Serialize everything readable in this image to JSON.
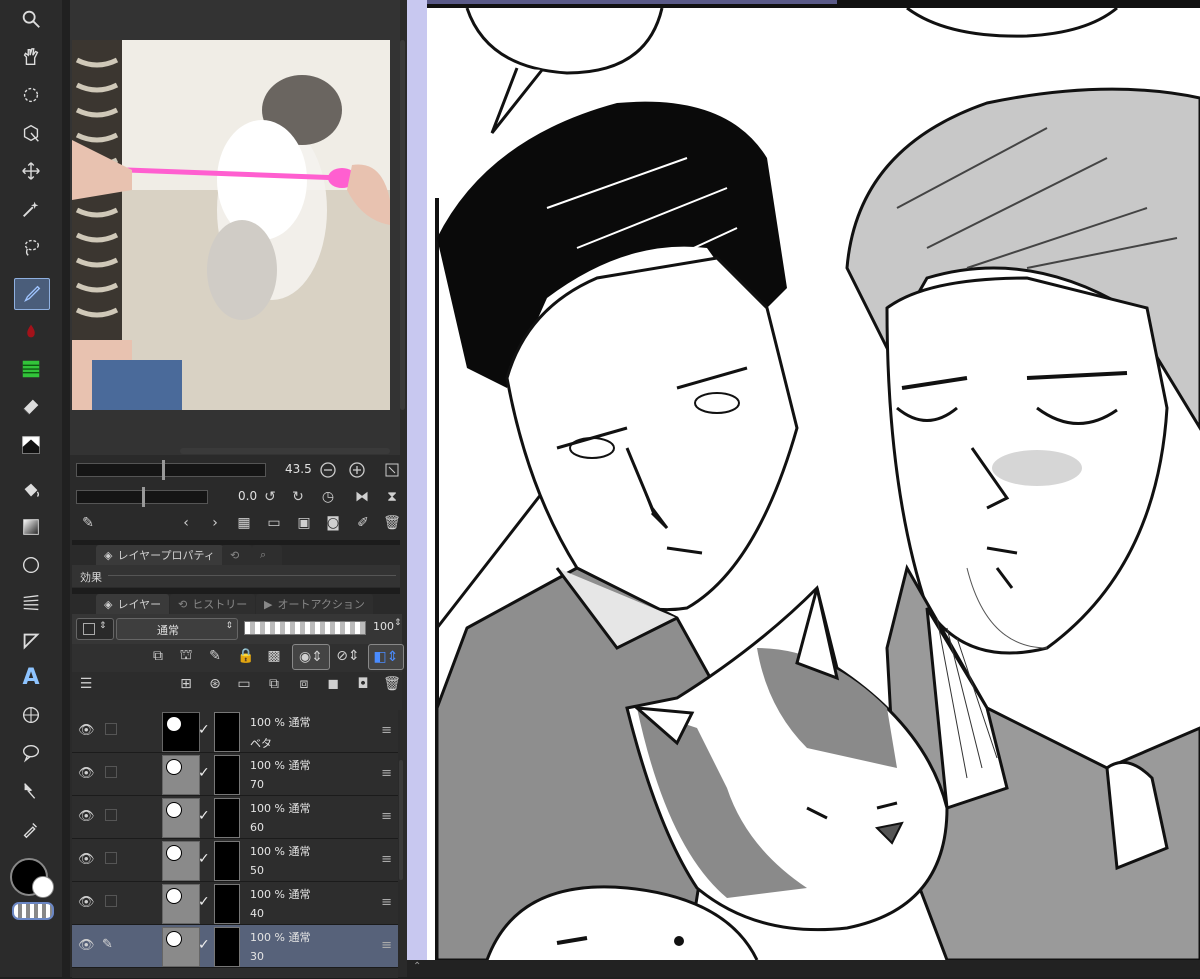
{
  "tools": [
    {
      "name": "zoom-tool",
      "icon": "magnifier-icon"
    },
    {
      "name": "hand-tool",
      "icon": "hand-icon"
    },
    {
      "name": "rotate-tool",
      "icon": "rotate-icon"
    },
    {
      "name": "object-tool",
      "icon": "object-icon"
    },
    {
      "name": "move-tool",
      "icon": "move-icon"
    },
    {
      "name": "auto-select-tool",
      "icon": "magic-wand-icon"
    },
    {
      "name": "lasso-tool",
      "icon": "lasso-icon"
    },
    {
      "name": "pen-tool",
      "icon": "pen-icon"
    },
    {
      "name": "blend-tool",
      "icon": "droplet-icon"
    },
    {
      "name": "tone-tool",
      "icon": "tone-icon"
    },
    {
      "name": "eraser-tool",
      "icon": "eraser-icon"
    },
    {
      "name": "gradient-fill-tool",
      "icon": "gradient-fill-icon"
    },
    {
      "name": "fill-tool",
      "icon": "bucket-icon"
    },
    {
      "name": "gradient-tool",
      "icon": "gradient-icon"
    },
    {
      "name": "figure-tool",
      "icon": "circle-icon"
    },
    {
      "name": "frame-tool",
      "icon": "frame-icon"
    },
    {
      "name": "ruler-tool",
      "icon": "ruler-icon"
    },
    {
      "name": "text-tool",
      "icon": "text-icon",
      "glyph": "A"
    },
    {
      "name": "frame-border-tool",
      "icon": "grid-icon"
    },
    {
      "name": "balloon-tool",
      "icon": "balloon-icon"
    },
    {
      "name": "correct-line-tool",
      "icon": "correct-line-icon"
    },
    {
      "name": "eyedropper-tool",
      "icon": "eyedropper-icon"
    }
  ],
  "navigator": {
    "zoom_value": "43.5",
    "rotation_value": "0.0",
    "zoom_level": 0.45,
    "rotation_level": 0.5
  },
  "layer_property_panel": {
    "tab_label": "レイヤープロパティ",
    "effect_label": "効果"
  },
  "layer_panel": {
    "tabs": [
      {
        "label": "レイヤー",
        "active": true
      },
      {
        "label": "ヒストリー",
        "active": false
      },
      {
        "label": "オートアクション",
        "active": false
      }
    ],
    "blend_mode": "通常",
    "opacity": "100",
    "layers": [
      {
        "percent": "100 %  通常",
        "name": "ベタ",
        "dark": true,
        "selected": false
      },
      {
        "percent": "100 %  通常",
        "name": "70",
        "dark": false,
        "selected": false
      },
      {
        "percent": "100 %  通常",
        "name": "60",
        "dark": false,
        "selected": false
      },
      {
        "percent": "100 %  通常",
        "name": "50",
        "dark": false,
        "selected": false
      },
      {
        "percent": "100 %  通常",
        "name": "40",
        "dark": false,
        "selected": false
      },
      {
        "percent": "100 %  通常",
        "name": "30",
        "dark": false,
        "selected": true
      }
    ]
  },
  "colors": {
    "accent": "#8fb0e0",
    "selected_row": "#57627a",
    "panel_bg": "#2a2a2a",
    "canvas_gutter": "#c8c8f0"
  }
}
